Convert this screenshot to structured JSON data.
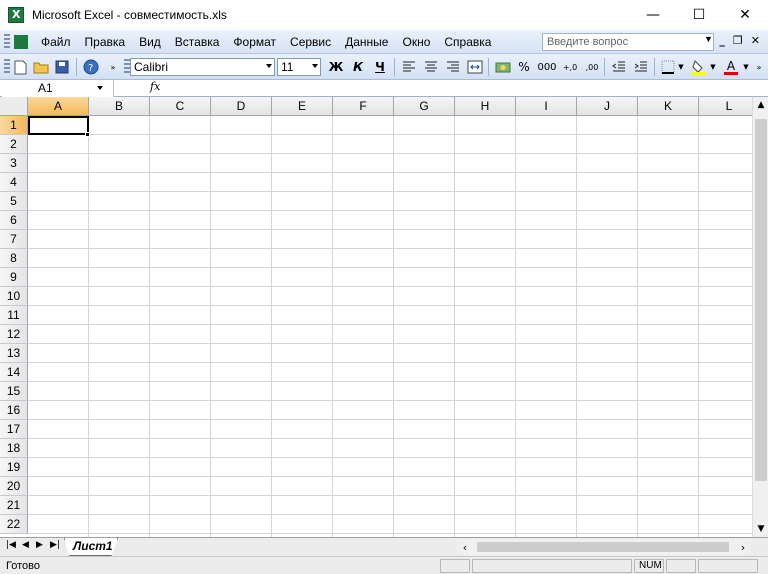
{
  "window": {
    "title": "Microsoft Excel - совместимость.xls",
    "minimize": "—",
    "maximize": "☐",
    "close": "✕"
  },
  "menu": {
    "items": [
      "Файл",
      "Правка",
      "Вид",
      "Вставка",
      "Формат",
      "Сервис",
      "Данные",
      "Окно",
      "Справка"
    ],
    "help_placeholder": "Введите вопрос",
    "mdi_minimize": "_",
    "mdi_restore": "❐",
    "mdi_close": "✕"
  },
  "toolbar": {
    "font_name": "Calibri",
    "font_size": "11",
    "bold": "Ж",
    "italic": "К",
    "underline": "Ч",
    "percent": "%",
    "thousands": "000",
    "increase_decimal": "+,0",
    "decrease_decimal": ",00",
    "font_color_letter": "A"
  },
  "formula_bar": {
    "name_box": "A1",
    "fx": "fx",
    "value": ""
  },
  "grid": {
    "columns": [
      "A",
      "B",
      "C",
      "D",
      "E",
      "F",
      "G",
      "H",
      "I",
      "J",
      "K",
      "L"
    ],
    "rows": [
      "1",
      "2",
      "3",
      "4",
      "5",
      "6",
      "7",
      "8",
      "9",
      "10",
      "11",
      "12",
      "13",
      "14",
      "15",
      "16",
      "17",
      "18",
      "19",
      "20",
      "21",
      "22"
    ],
    "active_column": "A",
    "active_row": "1"
  },
  "sheets": {
    "tabs": [
      "Лист1"
    ]
  },
  "status": {
    "text": "Готово",
    "num": "NUM"
  },
  "colors": {
    "active_header": "#f4b85a",
    "toolbar_bg": "#d7e3f5",
    "excel_green": "#1f7a3f"
  }
}
